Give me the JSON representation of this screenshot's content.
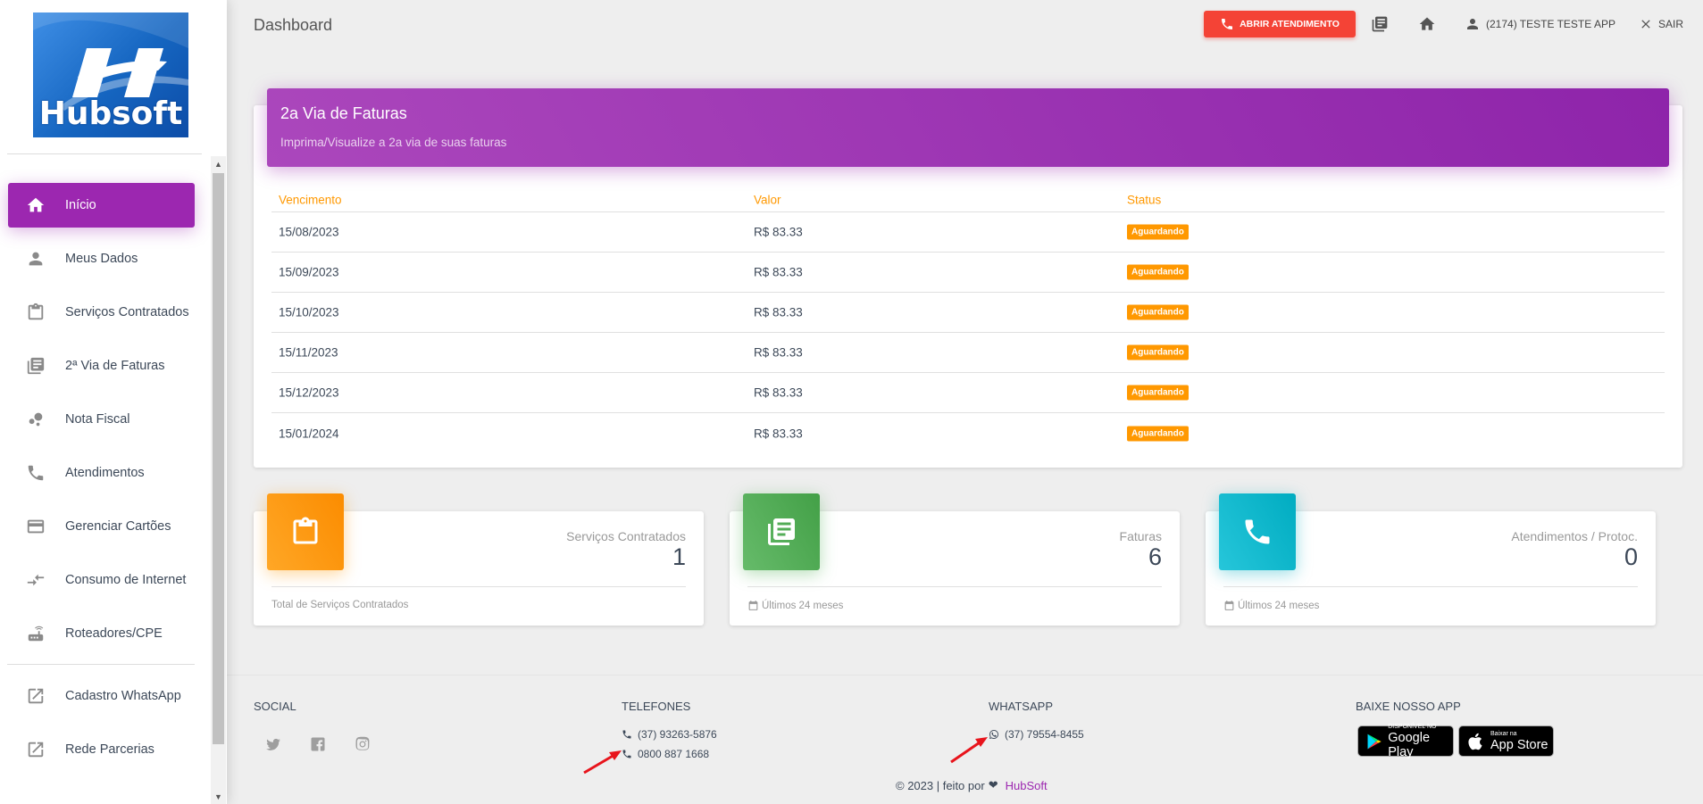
{
  "logo": {
    "text": "Hubsoft"
  },
  "sidebar": {
    "items": [
      {
        "label": "Início",
        "icon": "home-icon",
        "active": true
      },
      {
        "label": "Meus Dados",
        "icon": "person-icon"
      },
      {
        "label": "Serviços Contratados",
        "icon": "clipboard-icon"
      },
      {
        "label": "2ª Via de Faturas",
        "icon": "library-books-icon"
      },
      {
        "label": "Nota Fiscal",
        "icon": "bubble-chart-icon"
      },
      {
        "label": "Atendimentos",
        "icon": "phone-icon"
      },
      {
        "label": "Gerenciar Cartões",
        "icon": "credit-card-icon"
      },
      {
        "label": "Consumo de Internet",
        "icon": "compare-arrows-icon"
      },
      {
        "label": "Roteadores/CPE",
        "icon": "router-icon"
      },
      {
        "label": "Cadastro WhatsApp",
        "icon": "open-in-new-icon"
      },
      {
        "label": "Rede Parcerias",
        "icon": "open-in-new-icon"
      }
    ]
  },
  "header": {
    "title": "Dashboard",
    "atendimento_button": "ABRIR ATENDIMENTO",
    "user_label": "(2174) TESTE TESTE APP",
    "logout_label": "SAIR"
  },
  "invoices": {
    "title": "2a Via de Faturas",
    "subtitle": "Imprima/Visualize a 2a via de suas faturas",
    "columns": [
      "Vencimento",
      "Valor",
      "Status"
    ],
    "rows": [
      {
        "vencimento": "15/08/2023",
        "valor": "R$ 83.33",
        "status": "Aguardando"
      },
      {
        "vencimento": "15/09/2023",
        "valor": "R$ 83.33",
        "status": "Aguardando"
      },
      {
        "vencimento": "15/10/2023",
        "valor": "R$ 83.33",
        "status": "Aguardando"
      },
      {
        "vencimento": "15/11/2023",
        "valor": "R$ 83.33",
        "status": "Aguardando"
      },
      {
        "vencimento": "15/12/2023",
        "valor": "R$ 83.33",
        "status": "Aguardando"
      },
      {
        "vencimento": "15/01/2024",
        "valor": "R$ 83.33",
        "status": "Aguardando"
      }
    ]
  },
  "stats": [
    {
      "label": "Serviços Contratados",
      "value": "1",
      "footer": "Total de Serviços Contratados",
      "color": "#ff9800",
      "icon": "clipboard-icon"
    },
    {
      "label": "Faturas",
      "value": "6",
      "footer": "Últimos 24 meses",
      "color": "#4caf50",
      "icon": "library-books-icon"
    },
    {
      "label": "Atendimentos / Protoc.",
      "value": "0",
      "footer": "Últimos 24 meses",
      "color": "#00acc1",
      "icon": "phone-icon"
    }
  ],
  "footer": {
    "social_title": "SOCIAL",
    "phones_title": "TELEFONES",
    "phones": [
      "(37) 93263-5876",
      "0800 887 1668"
    ],
    "whatsapp_title": "WHATSAPP",
    "whatsapp": "(37) 79554-8455",
    "app_title": "BAIXE NOSSO APP",
    "google_play_small": "DISPONÍVEL NO",
    "google_play_big": "Google Play",
    "app_store_small": "Baixar na",
    "app_store_big": "App Store",
    "copyright": "© 2023 | feito por",
    "brand": "HubSoft"
  },
  "colors": {
    "primary": "#9c27b0",
    "danger": "#f44336",
    "warning": "#ff9800",
    "success": "#4caf50",
    "info": "#00acc1"
  }
}
